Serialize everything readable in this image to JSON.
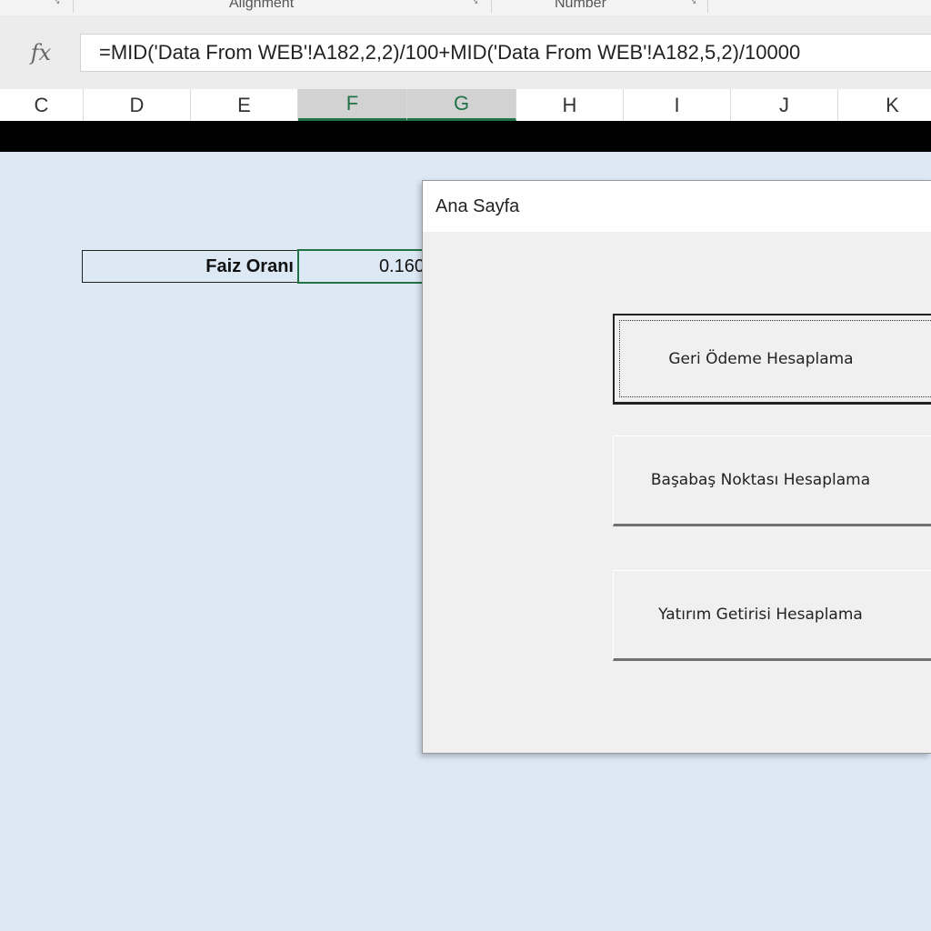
{
  "ribbon": {
    "groups": [
      {
        "label": "Alignment"
      },
      {
        "label": "Number"
      }
    ],
    "launcher_glyph": "↘"
  },
  "formula_bar": {
    "fx_label": "fx",
    "formula": "=MID('Data From WEB'!A182,2,2)/100+MID('Data From WEB'!A182,5,2)/10000"
  },
  "columns": [
    "C",
    "D",
    "E",
    "F",
    "G",
    "H",
    "I",
    "J",
    "K"
  ],
  "selected_columns": [
    "F",
    "G"
  ],
  "sheet": {
    "label": "Faiz Oranı",
    "value": "0.160"
  },
  "dialog": {
    "title": "Ana Sayfa",
    "buttons": [
      {
        "label": "Geri Ödeme Hesaplama"
      },
      {
        "label": "Başabaş Noktası Hesaplama"
      },
      {
        "label": "Yatırım Getirisi Hesaplama"
      }
    ]
  },
  "colors": {
    "accent": "#217346",
    "sheet_background": "#dce9f5",
    "dialog_background": "#f0f0f0"
  }
}
